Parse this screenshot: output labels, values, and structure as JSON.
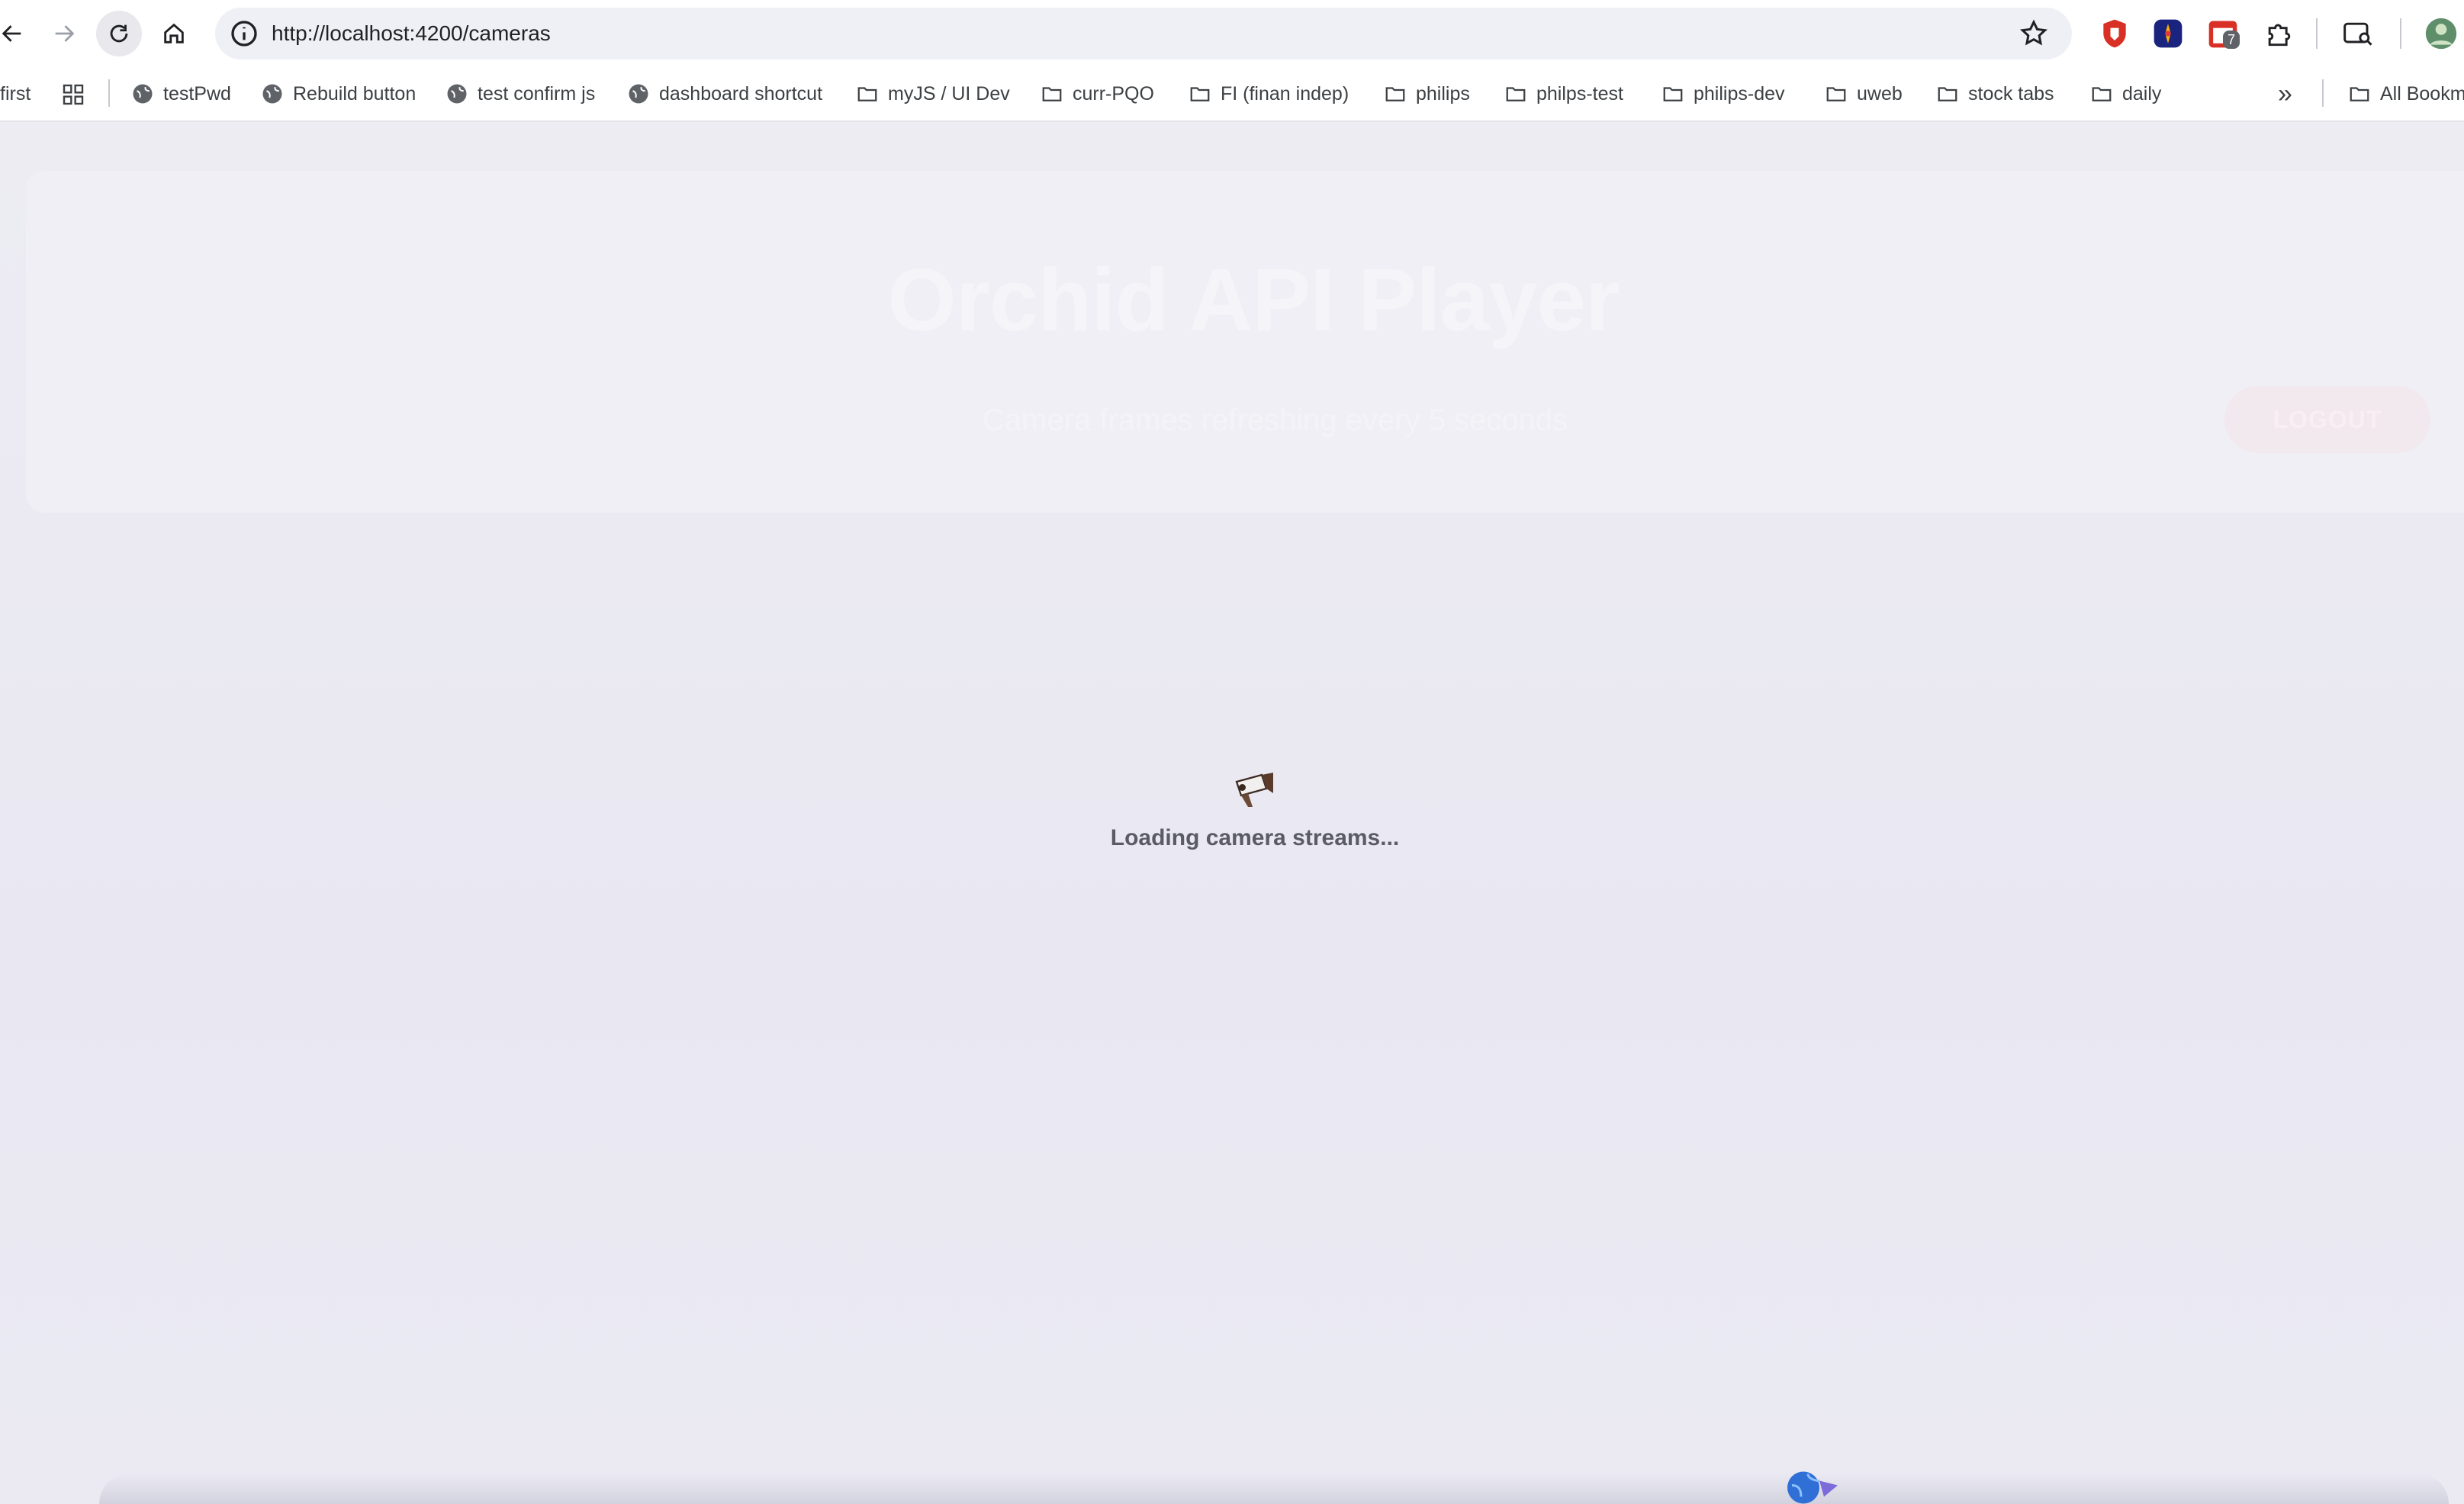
{
  "browser": {
    "url": "http://localhost:4200/cameras",
    "extension_badge": "7",
    "bookmarks": [
      {
        "label": "first",
        "type": "item"
      },
      {
        "label": "testPwd",
        "type": "site"
      },
      {
        "label": "Rebuild button",
        "type": "site"
      },
      {
        "label": "test confirm js",
        "type": "site"
      },
      {
        "label": "dashboard shortcut",
        "type": "site"
      },
      {
        "label": "myJS / UI Dev",
        "type": "folder"
      },
      {
        "label": "curr-PQO",
        "type": "folder"
      },
      {
        "label": "FI (finan indep)",
        "type": "folder"
      },
      {
        "label": "philips",
        "type": "folder"
      },
      {
        "label": "philps-test",
        "type": "folder"
      },
      {
        "label": "philips-dev",
        "type": "folder"
      },
      {
        "label": "uweb",
        "type": "folder"
      },
      {
        "label": "stock tabs",
        "type": "folder"
      },
      {
        "label": "daily",
        "type": "folder"
      }
    ],
    "more_bookmarks": "»",
    "all_bookmarks": "All Bookm"
  },
  "app": {
    "title": "Orchid API Player",
    "subtitle": "Camera frames refreshing every 5 seconds",
    "logout_label": "LOGOUT",
    "loading_text": "Loading camera streams..."
  },
  "colors": {
    "page_background": "#ebeaf3",
    "accent_logout": "#f1e9ed"
  }
}
